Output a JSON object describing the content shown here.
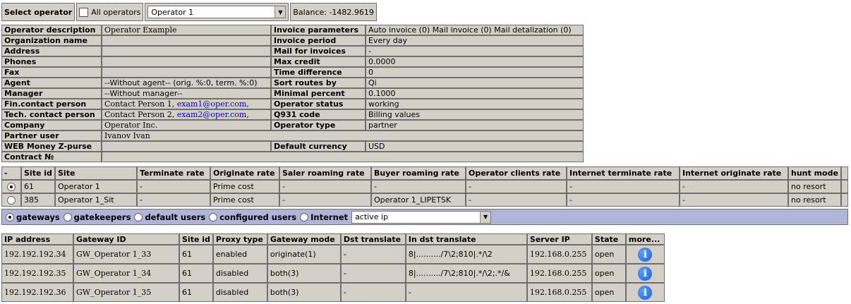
{
  "select_bar": {
    "label": "Select operator",
    "all_operators_label": "All operators",
    "operator_value": "Operator 1",
    "balance": "Balance: -1482.9619"
  },
  "operator_info": {
    "rows": [
      {
        "l": "Operator description",
        "v": "Operator Example",
        "l2": "Invoice parameters",
        "v2": "Auto invoice (0) Mail invoice (0) Mail detalization (0)"
      },
      {
        "l": "Organization name",
        "v": "",
        "l2": "Invoice period",
        "v2": "Every day"
      },
      {
        "l": "Address",
        "v": "",
        "l2": "Mail for invoices",
        "v2": "-"
      },
      {
        "l": "Phones",
        "v": "",
        "l2": "Max credit",
        "v2": "0.0000"
      },
      {
        "l": "Fax",
        "v": "",
        "l2": "Time difference",
        "v2": "0"
      },
      {
        "l": "Agent",
        "v": "--Without agent-- (orig. %:0, term. %:0)",
        "l2": "Sort routes by",
        "v2": "Qi"
      },
      {
        "l": "Manager",
        "v": "--Without manager--",
        "l2": "Minimal percent",
        "v2": "0.1000"
      },
      {
        "l": "Fin.contact person",
        "v": "Contact Person 1, ",
        "link": "exam1@oper.com",
        "tail": ",",
        "l2": "Operator status",
        "v2": "working"
      },
      {
        "l": "Tech. contact person",
        "v": "Contact Person 2, ",
        "link": "exam2@oper.com",
        "tail": ",",
        "l2": "Q931 code",
        "v2": "Billing values"
      },
      {
        "l": "Company",
        "v": "Operator Inc.",
        "l2": "Operator type",
        "v2": "partner"
      },
      {
        "l": "Partner user",
        "v": "Ivanov Ivan"
      },
      {
        "l": "WEB Money Z-purse",
        "v": "",
        "l2": "Default currency",
        "v2": "USD"
      },
      {
        "l": "Contract №",
        "v": ""
      }
    ]
  },
  "sites": {
    "headers": [
      "-",
      "Site id",
      "Site",
      "Terminate rate",
      "Originate rate",
      "Saler roaming rate",
      "Buyer roaming rate",
      "Operator clients rate",
      "Internet terminate rate",
      "Internet originate rate",
      "hunt mode"
    ],
    "rows": [
      {
        "selected": true,
        "cells": [
          "61",
          "Operator 1",
          "-",
          "Prime cost",
          "-",
          "-",
          "-",
          "-",
          "-",
          "no resort"
        ]
      },
      {
        "selected": false,
        "cells": [
          "385",
          "Operator 1_Sit",
          "-",
          "Prime cost",
          "-",
          "Operator 1_LIPETSK",
          "-",
          "-",
          "-",
          "no resort"
        ]
      }
    ]
  },
  "filter": {
    "options": [
      "gateways",
      "gatekeepers",
      "default users",
      "configured users",
      "Internet"
    ],
    "selected_index": 0,
    "ip_filter_value": "active ip"
  },
  "gateways": {
    "headers": [
      "IP address",
      "Gateway ID",
      "Site id",
      "Proxy type",
      "Gateway mode",
      "Dst translate",
      "In dst translate",
      "Server IP",
      "State",
      "more..."
    ],
    "rows": [
      [
        "192.192.192.34",
        "GW_Operator 1_33",
        "61",
        "enabled",
        "originate(1)",
        "-",
        "8|........../7\\2;810|.*/\\2",
        "192.168.0.255",
        "open"
      ],
      [
        "192.192.192.35",
        "GW_Operator 1_34",
        "61",
        "disabled",
        "both(3)",
        "-",
        "8|........../7\\2;810|.*/\\2;.*/&",
        "192.168.0.255",
        "open"
      ],
      [
        "192.192.192.36",
        "GW_Operator 1_35",
        "61",
        "disabled",
        "both(3)",
        "-",
        "-",
        "192.168.0.255",
        "open"
      ]
    ],
    "more_icon": "info-icon"
  }
}
